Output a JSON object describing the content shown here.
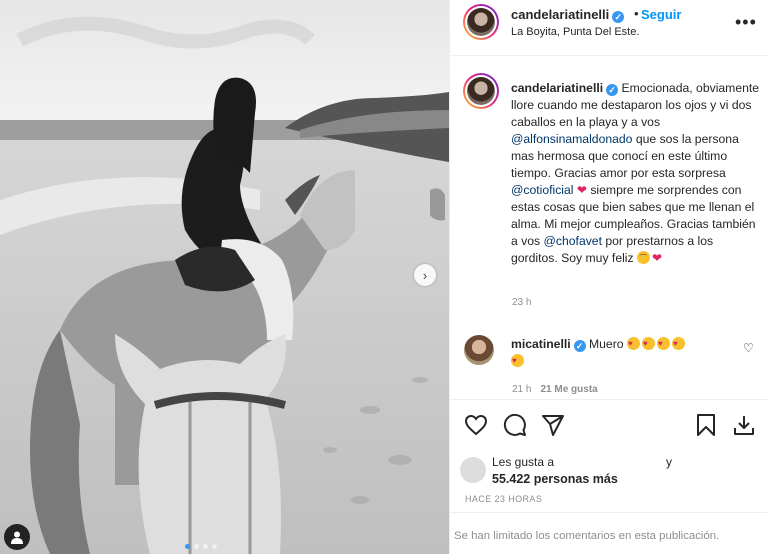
{
  "post": {
    "username": "candelariatinelli",
    "follow_label": "Seguir",
    "location": "La Boyita, Punta Del Este.",
    "more_label": "•••",
    "header_dot": "•"
  },
  "caption": {
    "username": "candelariatinelli",
    "t1": "Emocionada, obviamente llore cuando me destaparon los ojos y vi dos caballos en la playa y a vos ",
    "mention1": "@alfonsinamaldonado",
    "t2": " que sos la persona mas hermosa que conocí en este último tiempo. Gracias amor por esta sorpresa ",
    "mention2": "@cotioficial",
    "t3": " siempre me sorprendes con estas cosas que bien sabes que me llenan el alma. Mi mejor cumpleaños. Gracias también a vos ",
    "mention3": "@chofavet",
    "t4": " por prestarnos a los gorditos. Soy muy feliz ",
    "time": "23 h"
  },
  "comment": {
    "username": "micatinelli",
    "text": "Muero",
    "time": "21 h",
    "likes": "21 Me gusta"
  },
  "likes": {
    "prefix": "Les gusta a",
    "y": "y",
    "count": "55.422 personas más"
  },
  "post_time": "HACE 23 HORAS",
  "footer": "Se han limitado los comentarios en esta publicación.",
  "colors": {
    "accent": "#0095f6",
    "verified": "#3897f0",
    "muted": "#8e8e8e"
  }
}
